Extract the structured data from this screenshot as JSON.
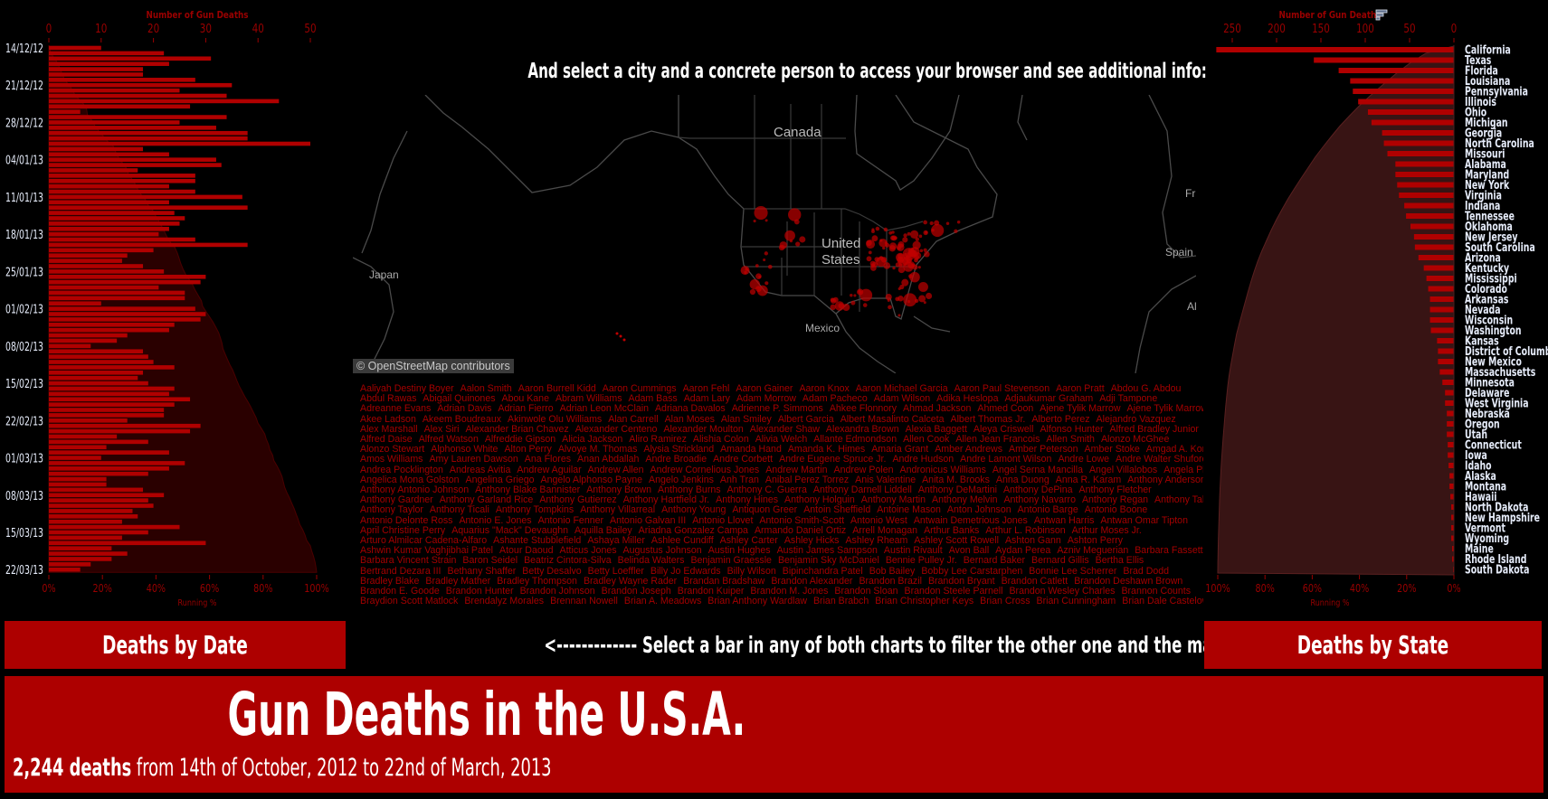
{
  "map": {
    "title": "And select a city and a concrete person to access your browser and see additional info:",
    "labels": {
      "canada": "Canada",
      "us_line1": "United",
      "us_line2": "States",
      "mexico": "Mexico",
      "japan": "Japan",
      "spain": "Spain",
      "france": "Fr",
      "algeria": "Alg"
    },
    "attribution": "© OpenStreetMap contributors",
    "marker_color": "#c00000"
  },
  "left_chart": {
    "title": "Number of Gun Deaths",
    "axis_ticks": [
      "0",
      "10",
      "20",
      "30",
      "40",
      "50"
    ],
    "pct_ticks": [
      "0%",
      "20%",
      "40%",
      "60%",
      "80%",
      "100%"
    ],
    "pct_label": "Running %",
    "date_labels": [
      "14/12/12",
      "21/12/12",
      "28/12/12",
      "04/01/13",
      "11/01/13",
      "18/01/13",
      "25/01/13",
      "01/02/13",
      "08/02/13",
      "15/02/13",
      "22/02/13",
      "01/03/13",
      "08/03/13",
      "15/03/13",
      "22/03/13"
    ],
    "bar_color": "#b00000",
    "area_color": "#2a0000"
  },
  "right_chart": {
    "title": "Number of Gun Deaths",
    "axis_ticks": [
      "250",
      "200",
      "150",
      "100",
      "50",
      "0"
    ],
    "pct_ticks": [
      "100%",
      "80%",
      "60%",
      "40%",
      "20%",
      "0%"
    ],
    "pct_label": "Running %",
    "sort_icon": "sort-descending-icon",
    "bar_color": "#b00000",
    "area_color": "#381414"
  },
  "chart_data": [
    {
      "type": "bar",
      "orientation": "horizontal",
      "title": "",
      "xlabel": "Number of Gun Deaths",
      "secondary_xlabel": "Running %",
      "xlim": [
        0,
        50
      ],
      "start_date": "14/12/12",
      "end_date": "22/03/13",
      "values": [
        10,
        22,
        31,
        23,
        18,
        18,
        28,
        35,
        25,
        34,
        44,
        27,
        6,
        34,
        25,
        32,
        38,
        38,
        50,
        18,
        23,
        32,
        33,
        17,
        28,
        28,
        23,
        28,
        37,
        23,
        38,
        24,
        26,
        25,
        23,
        21,
        28,
        38,
        20,
        15,
        14,
        18,
        22,
        30,
        29,
        21,
        26,
        26,
        10,
        28,
        30,
        29,
        24,
        23,
        15,
        13,
        8,
        18,
        19,
        20,
        24,
        18,
        17,
        19,
        24,
        23,
        27,
        24,
        22,
        22,
        15,
        29,
        27,
        13,
        19,
        11,
        23,
        10,
        26,
        23,
        19,
        11,
        11,
        18,
        22,
        19,
        20,
        16,
        17,
        14,
        25,
        19,
        14,
        30,
        12,
        15,
        12,
        8,
        6
      ]
    },
    {
      "type": "bar",
      "orientation": "horizontal",
      "title": "",
      "xlabel": "Number of Gun Deaths",
      "secondary_xlabel": "Running %",
      "xlim": [
        0,
        270
      ],
      "categories": [
        "California",
        "Texas",
        "Florida",
        "Louisiana",
        "Pennsylvania",
        "Illinois",
        "Ohio",
        "Michigan",
        "Georgia",
        "North Carolina",
        "Missouri",
        "Alabama",
        "Maryland",
        "New York",
        "Virginia",
        "Indiana",
        "Tennessee",
        "Oklahoma",
        "New Jersey",
        "South Carolina",
        "Arizona",
        "Kentucky",
        "Mississippi",
        "Colorado",
        "Arkansas",
        "Nevada",
        "Wisconsin",
        "Washington",
        "Kansas",
        "District of Columbia",
        "New Mexico",
        "Massachusetts",
        "Minnesota",
        "Delaware",
        "West Virginia",
        "Nebraska",
        "Oregon",
        "Utah",
        "Connecticut",
        "Iowa",
        "Idaho",
        "Alaska",
        "Montana",
        "Hawaii",
        "North Dakota",
        "New Hampshire",
        "Vermont",
        "Wyoming",
        "Maine",
        "Rhode Island",
        "South Dakota"
      ],
      "values": [
        268,
        158,
        130,
        117,
        114,
        108,
        97,
        93,
        81,
        79,
        75,
        66,
        66,
        64,
        62,
        56,
        54,
        49,
        45,
        44,
        40,
        34,
        31,
        29,
        27,
        27,
        27,
        26,
        19,
        18,
        18,
        16,
        13,
        10,
        10,
        8,
        8,
        8,
        7,
        7,
        6,
        5,
        5,
        4,
        3,
        3,
        3,
        3,
        2,
        2,
        1
      ]
    }
  ],
  "names": {
    "lines": [
      [
        "Aaliyah Destiny Boyer",
        "Aalon Smith",
        "Aaron Burrell Kidd",
        "Aaron Cummings",
        "Aaron Fehl",
        "Aaron Gainer",
        "Aaron Knox",
        "Aaron Michael Garcia",
        "Aaron Paul Stevenson",
        "Aaron Pratt",
        "Abdou G. Abdou"
      ],
      [
        "Abdul Rawas",
        "Abigail Quinones",
        "Abou Kane",
        "Abram Williams",
        "Adam Bass",
        "Adam Lary",
        "Adam Morrow",
        "Adam Pacheco",
        "Adam Wilson",
        "Adika Heslopa",
        "Adjaukumar Graham",
        "Adji Tampone"
      ],
      [
        "Adreanne Evans",
        "Adrian Davis",
        "Adrian Fierro",
        "Adrian Leon McClain",
        "Adriana Davalos",
        "Adrienne P. Simmons",
        "Ahkee Flonnory",
        "Ahmad Jackson",
        "Ahmed Coon",
        "Ajene Tylik Marrow",
        "Ajene Tylik Marrow"
      ],
      [
        "Akee Ladson",
        "Akeem Boudreaux",
        "Akinwole Olu Williams",
        "Alan Carrell",
        "Alan Moses",
        "Alan Smiley",
        "Albert Garcia",
        "Albert Masalinto Calceta",
        "Albert Thomas Jr.",
        "Alberto Perez",
        "Alejandro Vazquez"
      ],
      [
        "Alex Marshall",
        "Alex Siri",
        "Alexander Brian Chavez",
        "Alexander Centeno",
        "Alexander Moulton",
        "Alexander Shaw",
        "Alexandra Brown",
        "Alexia Baggett",
        "Aleya Criswell",
        "Alfonso Hunter",
        "Alfred Bradley Junior"
      ],
      [
        "Alfred Daise",
        "Alfred Watson",
        "Alfreddie Gipson",
        "Alicia Jackson",
        "Aliro Ramirez",
        "Alishia Colon",
        "Alivia Welch",
        "Allante Edmondson",
        "Allen Cook",
        "Allen Jean Francois",
        "Allen Smith",
        "Alonzo McGhee"
      ],
      [
        "Alonzo Stewart",
        "Alphonso White",
        "Alton Perry",
        "Alvoye M. Thomas",
        "Alysia Strickland",
        "Amanda Hand",
        "Amanda K. Himes",
        "Amaria Grant",
        "Amber Andrews",
        "Amber Peterson",
        "Amber Stoke",
        "Amgad A. Konds"
      ],
      [
        "Amos Williams",
        "Amy Lauren Dawson",
        "Ana Flores",
        "Anan Abdallah",
        "Andre Broadie",
        "Andre Corbett",
        "Andre Eugene Spruce Jr.",
        "Andre Hudson",
        "Andre Lamont Wilson",
        "Andre Lowe",
        "Andre Walter Shuford"
      ],
      [
        "Andrea Pocklington",
        "Andreas Avitia",
        "Andrew Aguilar",
        "Andrew Allen",
        "Andrew Cornelious Jones",
        "Andrew Martin",
        "Andrew Polen",
        "Andronicus Williams",
        "Angel Serna Mancilla",
        "Angel Villalobos",
        "Angela Player"
      ],
      [
        "Angelica Mona Golston",
        "Angelina Griego",
        "Angelo Alphonso Payne",
        "Angelo Jenkins",
        "Anh Tran",
        "Anibal Perez Torrez",
        "Anis Valentine",
        "Anita M. Brooks",
        "Anna Duong",
        "Anna R. Karam",
        "Anthony Anderson"
      ],
      [
        "Anthony Antonio Johnson",
        "Anthony Blake Bannister",
        "Anthony Brown",
        "Anthony Burns",
        "Anthony C. Guerra",
        "Anthony Darnell Liddell",
        "Anthony DeMartini",
        "Anthony DePina",
        "Anthony Fletcher"
      ],
      [
        "Anthony Gardner",
        "Anthony Garland Rice",
        "Anthony Gutierrez",
        "Anthony Hartfield Jr.",
        "Anthony Hines",
        "Anthony Holguin",
        "Anthony Martin",
        "Anthony Melvin",
        "Anthony Navarro",
        "Anthony Regan",
        "Anthony Tabor"
      ],
      [
        "Anthony Taylor",
        "Anthony Ticali",
        "Anthony Tompkins",
        "Anthony Villarreal",
        "Anthony Young",
        "Antiquon Greer",
        "Antoin Sheffield",
        "Antoine Mason",
        "Anton Johnson",
        "Antonio Barge",
        "Antonio Boone"
      ],
      [
        "Antonio Delonte Ross",
        "Antonio E. Jones",
        "Antonio Fenner",
        "Antonio Galvan III",
        "Antonio Llovet",
        "Antonio Smith-Scott",
        "Antonio West",
        "Antwain Demetrious Jones",
        "Antwan Harris",
        "Antwan Omar Tipton"
      ],
      [
        "April Christine Perry",
        "Aquarius \"Mack\" Devaughn",
        "Aquilla Bailey",
        "Ariadna Gonzalez Campa",
        "Armando Daniel Ortiz",
        "Arrell Monagan",
        "Arthur Banks",
        "Arthur L. Robinson",
        "Arthur Moses Jr."
      ],
      [
        "Arturo Almilcar Cadena-Alfaro",
        "Ashante Stubblefield",
        "Ashaya Miller",
        "Ashlee Cundiff",
        "Ashley Carter",
        "Ashley Hicks",
        "Ashley Rheam",
        "Ashley Scott Rowell",
        "Ashton Gann",
        "Ashton Perry"
      ],
      [
        "Ashwin Kumar Vaghjibhai Patel",
        "Atour Daoud",
        "Atticus Jones",
        "Augustus Johnson",
        "Austin Hughes",
        "Austin James Sampson",
        "Austin Rivault",
        "Avon Ball",
        "Aydan Perea",
        "Azniv Meguerian",
        "Barbara Fassett"
      ],
      [
        "Barbara Vincent Strain",
        "Baron Seidel",
        "Beatriz Cintora-Silva",
        "Belinda Walters",
        "Benjamin Graessle",
        "Benjamin Sky McDaniel",
        "Bennie Pulley Jr.",
        "Bernard Baker",
        "Bernard Gillis",
        "Bertha Ellis"
      ],
      [
        "Bertrand Dezara III",
        "Bethany Shaffer",
        "Betty Desalvo",
        "Betty Loeffler",
        "Billy Jo Edwards",
        "Billy Wilson",
        "Bipinchandra Patel",
        "Bob Bailey",
        "Bobby Lee Carstarphen",
        "Bonnie Lee Scherrer",
        "Brad Dodd"
      ],
      [
        "Bradley Blake",
        "Bradley Mather",
        "Bradley Thompson",
        "Bradley Wayne Rader",
        "Brandan Bradshaw",
        "Brandon Alexander",
        "Brandon Brazil",
        "Brandon Bryant",
        "Brandon Catlett",
        "Brandon Deshawn Brown"
      ],
      [
        "Brandon E. Goode",
        "Brandon Hunter",
        "Brandon Johnson",
        "Brandon Joseph",
        "Brandon Kuiper",
        "Brandon M. Jones",
        "Brandon Sloan",
        "Brandon Steele Parnell",
        "Brandon Wesley Charles",
        "Brannon Counts"
      ],
      [
        "Braydion Scott Matlock",
        "Brendalyz Morales",
        "Brennan Nowell",
        "Brian A. Meadows",
        "Brian Anthony Wardlaw",
        "Brian Brabch",
        "Brian Christopher Keys",
        "Brian Cross",
        "Brian Cunningham",
        "Brian Dale Castelow"
      ]
    ],
    "more": "•••",
    "text_color": "#a50000"
  },
  "footer": {
    "deaths_by_date": "Deaths by Date",
    "instruction": "<------------- Select a bar in any of both charts to filter the other one and the map ------------->",
    "deaths_by_state": "Deaths by State",
    "title": "Gun Deaths in the U.S.A.",
    "subtitle_count": "2,244 deaths",
    "subtitle_rest": " from 14th of October, 2012 to 22nd of March, 2013",
    "box_color": "#ad0000"
  }
}
